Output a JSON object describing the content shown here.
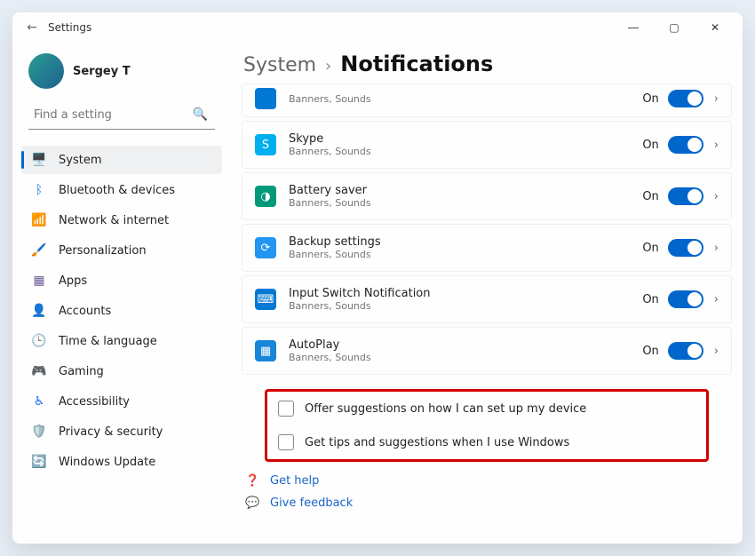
{
  "window": {
    "title": "Settings"
  },
  "user": {
    "name": "Sergey T"
  },
  "search": {
    "placeholder": "Find a setting"
  },
  "nav": {
    "items": [
      {
        "label": "System"
      },
      {
        "label": "Bluetooth & devices"
      },
      {
        "label": "Network & internet"
      },
      {
        "label": "Personalization"
      },
      {
        "label": "Apps"
      },
      {
        "label": "Accounts"
      },
      {
        "label": "Time & language"
      },
      {
        "label": "Gaming"
      },
      {
        "label": "Accessibility"
      },
      {
        "label": "Privacy & security"
      },
      {
        "label": "Windows Update"
      }
    ],
    "selected": "System"
  },
  "breadcrumb": {
    "parent": "System",
    "chevron": "›",
    "current": "Notifications"
  },
  "rows": [
    {
      "title": "",
      "sub": "Banners, Sounds",
      "state": "On",
      "icon_bg": "ic-store",
      "clipped": true
    },
    {
      "title": "Skype",
      "sub": "Banners, Sounds",
      "state": "On",
      "icon_bg": "ic-sk",
      "icon_glyph": "S"
    },
    {
      "title": "Battery saver",
      "sub": "Banners, Sounds",
      "state": "On",
      "icon_bg": "ic-bs",
      "icon_glyph": "◑"
    },
    {
      "title": "Backup settings",
      "sub": "Banners, Sounds",
      "state": "On",
      "icon_bg": "ic-bk",
      "icon_glyph": "⟳"
    },
    {
      "title": "Input Switch Notification",
      "sub": "Banners, Sounds",
      "state": "On",
      "icon_bg": "ic-is",
      "icon_glyph": "⌨"
    },
    {
      "title": "AutoPlay",
      "sub": "Banners, Sounds",
      "state": "On",
      "icon_bg": "ic-ap",
      "icon_glyph": "▦"
    }
  ],
  "checks": {
    "c1": "Offer suggestions on how I can set up my device",
    "c2": "Get tips and suggestions when I use Windows"
  },
  "links": {
    "help": "Get help",
    "feedback": "Give feedback"
  },
  "colors": {
    "accent": "#0066cc",
    "highlight_box": "#d40000"
  }
}
